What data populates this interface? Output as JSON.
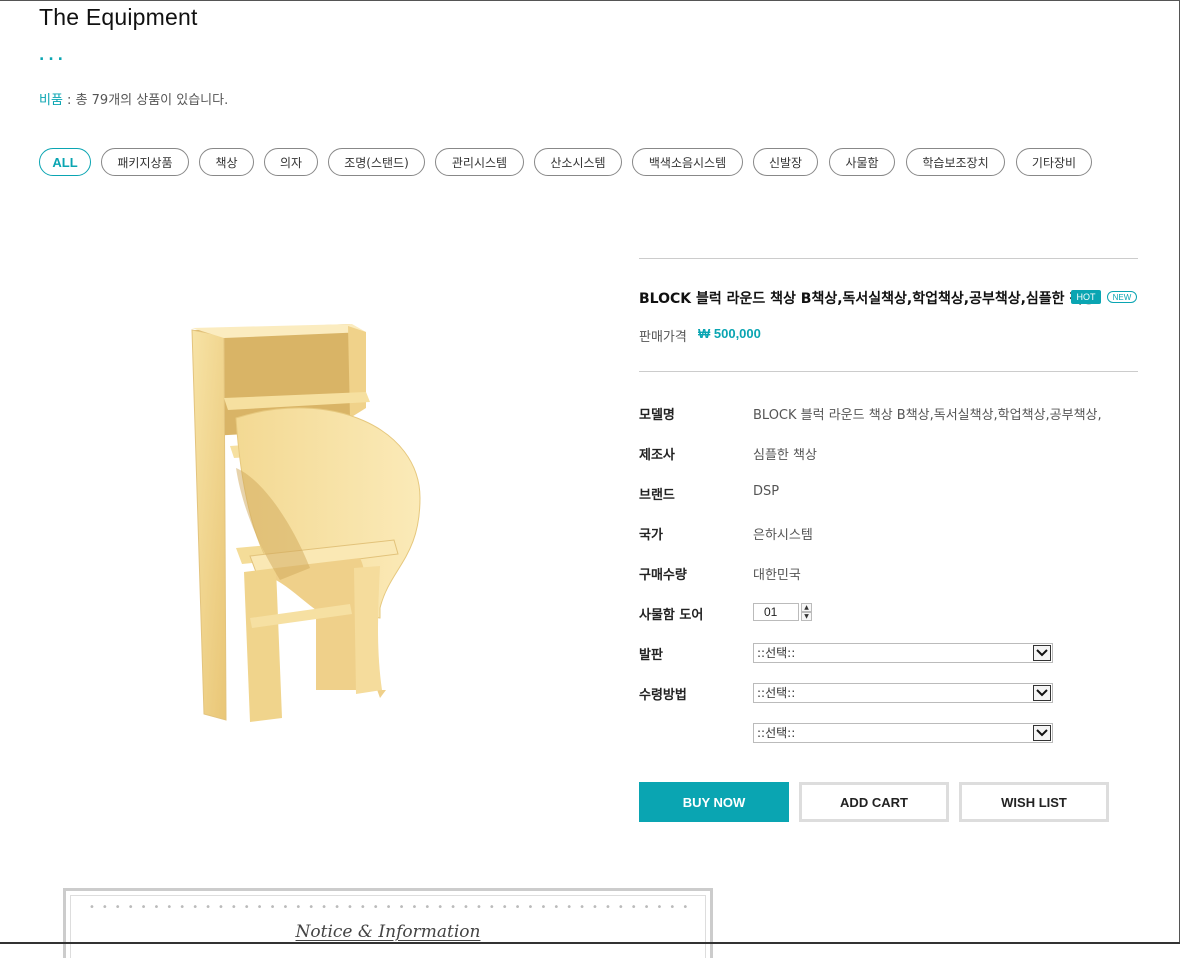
{
  "header": {
    "title": "The Equipment",
    "dots": "...",
    "category": "비품",
    "count_text": " : 총 79개의 상품이 있습니다."
  },
  "filters": [
    "ALL",
    "패키지상품",
    "책상",
    "의자",
    "조명(스탠드)",
    "관리시스템",
    "산소시스템",
    "백색소음시스템",
    "신발장",
    "사물함",
    "학습보조장치",
    "기타장비"
  ],
  "product": {
    "name": "BLOCK 블럭 라운드 책상 B책상,독서실책상,학업책상,공부책상,심플한 책상",
    "badges": {
      "hot": "HOT",
      "new": "NEW"
    },
    "price_label": "판매가격",
    "price": "₩ 500,000",
    "specs": [
      {
        "label": "모델명",
        "value": "BLOCK 블럭 라운드 책상 B책상,독서실책상,학업책상,공부책상,"
      },
      {
        "label": "제조사",
        "value": "심플한 책상"
      },
      {
        "label": "브랜드",
        "value": "DSP"
      },
      {
        "label": "국가",
        "value": "은하시스템"
      },
      {
        "label": "구매수량",
        "value": "대한민국"
      }
    ],
    "qty_label": "사물함 도어",
    "qty_value": "01",
    "options": [
      {
        "label": "발판",
        "selected": "::선택::"
      },
      {
        "label": "수령방법",
        "selected": "::선택::"
      },
      {
        "label": "",
        "selected": "::선택::"
      }
    ]
  },
  "buttons": {
    "buy": "BUY NOW",
    "cart": "ADD CART",
    "wish": "WISH LIST"
  },
  "notice": {
    "title": "Notice & Information"
  },
  "colors": {
    "accent": "#0aa5b2",
    "wood": "#f2d589"
  }
}
